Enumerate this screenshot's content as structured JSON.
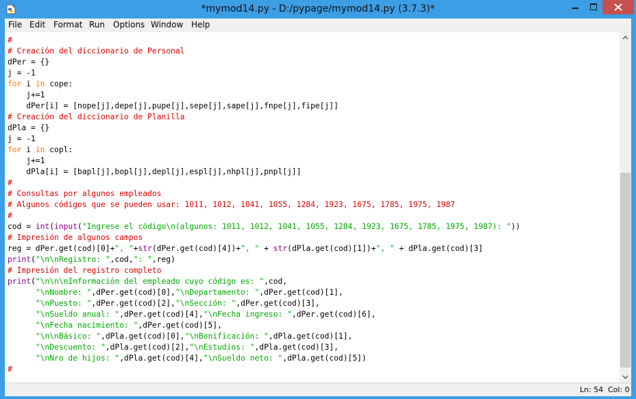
{
  "window": {
    "title": "*mymod14.py - D:/pypage/mymod14.py (3.7.3)*",
    "icons": {
      "app": "python-idle-icon",
      "minimize": "minimize-icon",
      "maximize": "maximize-icon",
      "close": "close-icon"
    },
    "colors": {
      "titlebar": "#3c9ee5",
      "close_button": "#c7504f"
    }
  },
  "menu": [
    "File",
    "Edit",
    "Format",
    "Run",
    "Options",
    "Window",
    "Help"
  ],
  "editor": {
    "syntax_colors": {
      "comment": "#dd0000",
      "keyword": "#ff7700",
      "builtin": "#900090",
      "string": "#00aa00",
      "default": "#000000"
    },
    "lines": [
      [
        [
          "cm",
          "#"
        ]
      ],
      [
        [
          "cm",
          "# Creación del diccionario de Personal"
        ]
      ],
      [
        [
          "",
          "dPer = {}"
        ]
      ],
      [
        [
          "",
          "j = -1"
        ]
      ],
      [
        [
          "kw",
          "for"
        ],
        [
          "",
          " i "
        ],
        [
          "kw",
          "in"
        ],
        [
          "",
          " cope:"
        ]
      ],
      [
        [
          "",
          "    j+=1"
        ]
      ],
      [
        [
          "",
          "    dPer[i] = [nope[j],depe[j],pupe[j],sepe[j],sape[j],fnpe[j],fipe[j]]"
        ]
      ],
      [
        [
          "cm",
          "# Creación del diccionario de Planilla"
        ]
      ],
      [
        [
          "",
          "dPla = {}"
        ]
      ],
      [
        [
          "",
          "j = -1"
        ]
      ],
      [
        [
          "kw",
          "for"
        ],
        [
          "",
          " i "
        ],
        [
          "kw",
          "in"
        ],
        [
          "",
          " copl:"
        ]
      ],
      [
        [
          "",
          "    j+=1"
        ]
      ],
      [
        [
          "",
          "    dPla[i] = [bapl[j],bopl[j],depl[j],espl[j],nhpl[j],pnpl[j]]"
        ]
      ],
      [
        [
          "cm",
          "#"
        ]
      ],
      [
        [
          "cm",
          "# Consultas por algunos empleados"
        ]
      ],
      [
        [
          "cm",
          "# Algunos códigos que se pueden usar: 1011, 1012, 1041, 1055, 1284, 1923, 1675, 1785, 1975, 1987"
        ]
      ],
      [
        [
          "cm",
          "#"
        ]
      ],
      [
        [
          "",
          "cod = "
        ],
        [
          "bi",
          "int"
        ],
        [
          "",
          "("
        ],
        [
          "bi",
          "input"
        ],
        [
          "",
          "("
        ],
        [
          "st",
          "\"Ingrese el código\\n(algunos: 1011, 1012, 1041, 1055, 1284, 1923, 1675, 1785, 1975, 1987): \""
        ],
        [
          "",
          "))"
        ]
      ],
      [
        [
          "cm",
          "# Impresión de algunos campos"
        ]
      ],
      [
        [
          "",
          "reg = dPer.get(cod)[0]+"
        ],
        [
          "st",
          "\", \""
        ],
        [
          "",
          "+"
        ],
        [
          "bi",
          "str"
        ],
        [
          "",
          "(dPer.get(cod)[4])+"
        ],
        [
          "st",
          "\", \""
        ],
        [
          "",
          " + "
        ],
        [
          "bi",
          "str"
        ],
        [
          "",
          "(dPla.get(cod)[1])+"
        ],
        [
          "st",
          "\", \""
        ],
        [
          "",
          " + dPla.get(cod)[3]"
        ]
      ],
      [
        [
          "bi",
          "print"
        ],
        [
          "",
          "("
        ],
        [
          "st",
          "\"\\n\\nRegistro: \""
        ],
        [
          "",
          ",cod,"
        ],
        [
          "st",
          "\": \""
        ],
        [
          "",
          ",reg)"
        ]
      ],
      [
        [
          "cm",
          "# Impresión del registro completo"
        ]
      ],
      [
        [
          "bi",
          "print"
        ],
        [
          "",
          "("
        ],
        [
          "st",
          "\"\\n\\n\\nInformación del empleado cuyo código es: \""
        ],
        [
          "",
          ",cod,"
        ]
      ],
      [
        [
          "",
          "      "
        ],
        [
          "st",
          "\"\\nNombre: \""
        ],
        [
          "",
          ",dPer.get(cod)[0],"
        ],
        [
          "st",
          "\"\\nDepartamento: \""
        ],
        [
          "",
          ",dPer.get(cod)[1],"
        ]
      ],
      [
        [
          "",
          "      "
        ],
        [
          "st",
          "\"\\nPuesto: \""
        ],
        [
          "",
          ",dPer.get(cod)[2],"
        ],
        [
          "st",
          "\"\\nSección: \""
        ],
        [
          "",
          ",dPer.get(cod)[3],"
        ]
      ],
      [
        [
          "",
          "      "
        ],
        [
          "st",
          "\"\\nSueldo anual: \""
        ],
        [
          "",
          ",dPer.get(cod)[4],"
        ],
        [
          "st",
          "\"\\nFecha ingreso: \""
        ],
        [
          "",
          ",dPer.get(cod)[6],"
        ]
      ],
      [
        [
          "",
          "      "
        ],
        [
          "st",
          "\"\\nFecha nacimiento: \""
        ],
        [
          "",
          ",dPer.get(cod)[5],"
        ]
      ],
      [
        [
          "",
          "      "
        ],
        [
          "st",
          "\"\\n\\nBásico: \""
        ],
        [
          "",
          ",dPla.get(cod)[0],"
        ],
        [
          "st",
          "\"\\nBonificación: \""
        ],
        [
          "",
          ",dPla.get(cod)[1],"
        ]
      ],
      [
        [
          "",
          "      "
        ],
        [
          "st",
          "\"\\nDescuento: \""
        ],
        [
          "",
          ",dPla.get(cod)[2],"
        ],
        [
          "st",
          "\"\\nEstudios: \""
        ],
        [
          "",
          ",dPla.get(cod)[3],"
        ]
      ],
      [
        [
          "",
          "      "
        ],
        [
          "st",
          "\"\\nNro de hijos: \""
        ],
        [
          "",
          ",dPla.get(cod)[4],"
        ],
        [
          "st",
          "\"\\nSueldo neto: \""
        ],
        [
          "",
          ",dPla.get(cod)[5])"
        ]
      ],
      [
        [
          "cm",
          "#"
        ]
      ]
    ],
    "cursor_line": 31
  },
  "status": {
    "line": "Ln: 54",
    "column": "Col: 0"
  }
}
